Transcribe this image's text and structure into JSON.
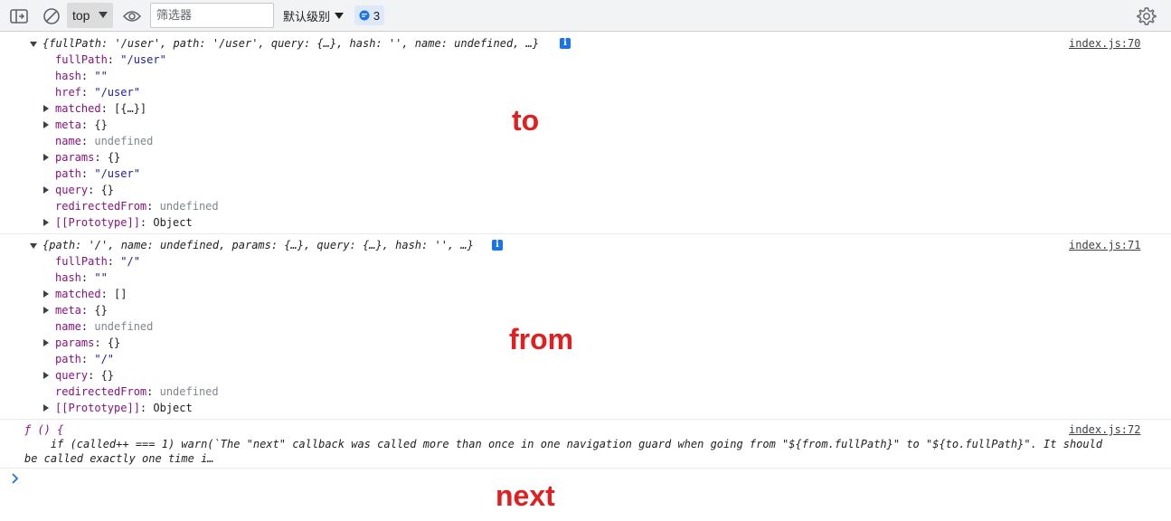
{
  "toolbar": {
    "context_label": "top",
    "filter_placeholder": "筛选器",
    "levels_label": "默认级别",
    "issues_count": "3",
    "icons": [
      "sidebar-toggle-icon",
      "clear-console-icon",
      "live-expression-eye-icon",
      "gear-icon"
    ]
  },
  "messages": [
    {
      "summary": "{fullPath: '/user', path: '/user', query: {…}, hash: '', name: undefined, …}",
      "source": "index.js:70",
      "props": [
        {
          "key": "fullPath",
          "value": "\"/user\"",
          "kind": "str",
          "expandable": false
        },
        {
          "key": "hash",
          "value": "\"\"",
          "kind": "str",
          "expandable": false
        },
        {
          "key": "href",
          "value": "\"/user\"",
          "kind": "str",
          "expandable": false
        },
        {
          "key": "matched",
          "value": "[{…}]",
          "kind": "obj",
          "expandable": true
        },
        {
          "key": "meta",
          "value": "{}",
          "kind": "obj",
          "expandable": true
        },
        {
          "key": "name",
          "value": "undefined",
          "kind": "undef",
          "expandable": false
        },
        {
          "key": "params",
          "value": "{}",
          "kind": "obj",
          "expandable": true
        },
        {
          "key": "path",
          "value": "\"/user\"",
          "kind": "str",
          "expandable": false
        },
        {
          "key": "query",
          "value": "{}",
          "kind": "obj",
          "expandable": true
        },
        {
          "key": "redirectedFrom",
          "value": "undefined",
          "kind": "undef",
          "expandable": false
        },
        {
          "key": "[[Prototype]]",
          "value": "Object",
          "kind": "obj",
          "expandable": true
        }
      ]
    },
    {
      "summary": "{path: '/', name: undefined, params: {…}, query: {…}, hash: '', …}",
      "source": "index.js:71",
      "props": [
        {
          "key": "fullPath",
          "value": "\"/\"",
          "kind": "str",
          "expandable": false
        },
        {
          "key": "hash",
          "value": "\"\"",
          "kind": "str",
          "expandable": false
        },
        {
          "key": "matched",
          "value": "[]",
          "kind": "obj",
          "expandable": true
        },
        {
          "key": "meta",
          "value": "{}",
          "kind": "obj",
          "expandable": true
        },
        {
          "key": "name",
          "value": "undefined",
          "kind": "undef",
          "expandable": false
        },
        {
          "key": "params",
          "value": "{}",
          "kind": "obj",
          "expandable": true
        },
        {
          "key": "path",
          "value": "\"/\"",
          "kind": "str",
          "expandable": false
        },
        {
          "key": "query",
          "value": "{}",
          "kind": "obj",
          "expandable": true
        },
        {
          "key": "redirectedFrom",
          "value": "undefined",
          "kind": "undef",
          "expandable": false
        },
        {
          "key": "[[Prototype]]",
          "value": "Object",
          "kind": "obj",
          "expandable": true
        }
      ]
    }
  ],
  "function_message": {
    "line1": "ƒ () {",
    "line2": "    if (called++ === 1) warn(`The \"next\" callback was called more than once in one navigation guard when going from \"${from.fullPath}\" to \"${to.fullPath}\". It should",
    "line3": "be called exactly one time i…",
    "source": "index.js:72"
  },
  "annotations": {
    "to": "to",
    "from": "from",
    "next": "next"
  },
  "colors": {
    "annotation": "#e02020",
    "key": "#881280",
    "string": "#1a1aa6",
    "undefined": "#80868b",
    "accent": "#1a73e8"
  }
}
